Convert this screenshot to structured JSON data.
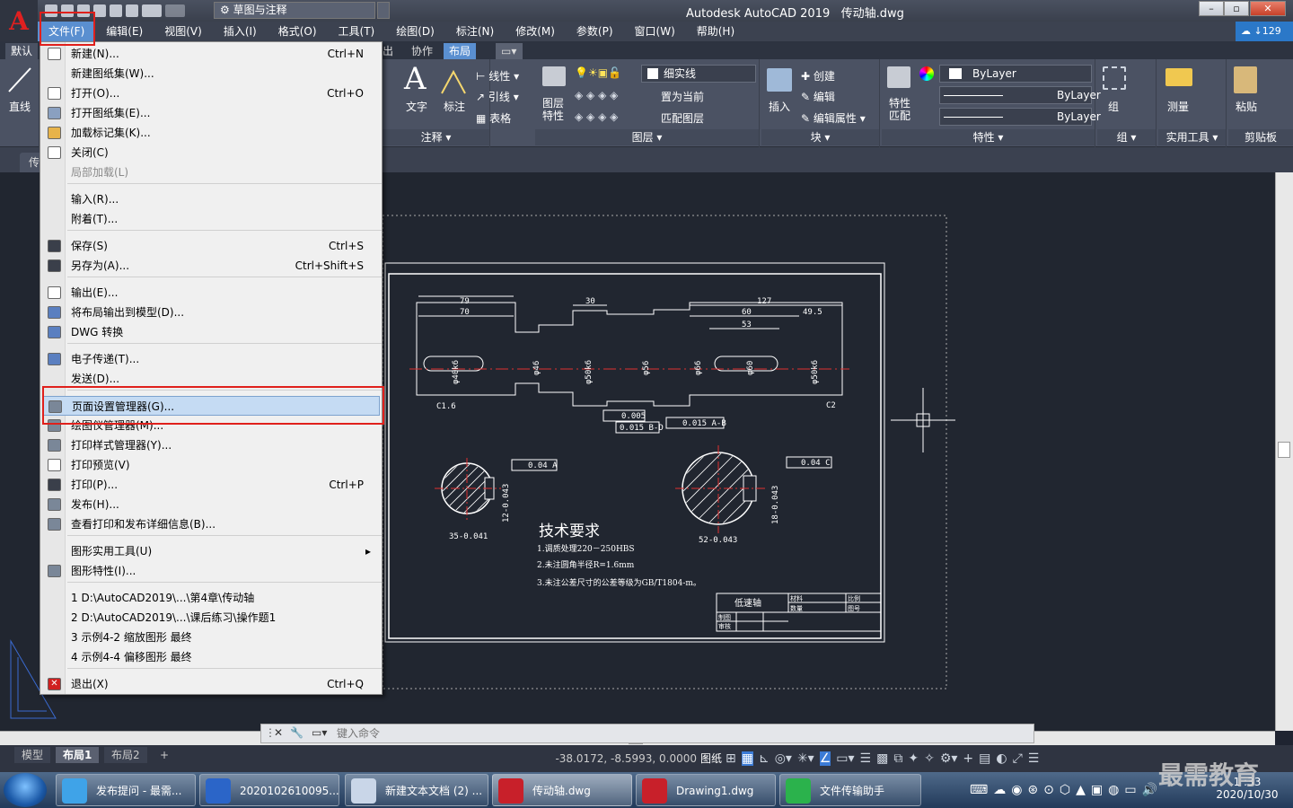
{
  "window": {
    "app_title": "Autodesk AutoCAD 2019",
    "file_name": "传动轴.dwg",
    "workspace": "草图与注释",
    "cloud_badge": "129"
  },
  "menubar": [
    "文件(F)",
    "编辑(E)",
    "视图(V)",
    "插入(I)",
    "格式(O)",
    "工具(T)",
    "绘图(D)",
    "标注(N)",
    "修改(M)",
    "参数(P)",
    "窗口(W)",
    "帮助(H)"
  ],
  "ribbon_tabs": [
    "默认",
    "出",
    "协作",
    "布局"
  ],
  "ribbon": {
    "draw_line": "直线",
    "annotation": {
      "text": "文字",
      "dim": "标注",
      "linear": "线性",
      "leader": "引线",
      "table": "表格",
      "title": "注释"
    },
    "layers": {
      "props": "图层\n特性",
      "current_layer": "细实线",
      "set_current": "置为当前",
      "match_layer": "匹配图层",
      "title": "图层"
    },
    "block": {
      "insert": "插入",
      "create": "创建",
      "edit": "编辑",
      "edit_attr": "编辑属性",
      "title": "块"
    },
    "properties": {
      "match": "特性\n匹配",
      "color": "ByLayer",
      "linetype": "ByLayer",
      "lineweight": "ByLayer",
      "title": "特性"
    },
    "group": {
      "label": "组",
      "title": "组"
    },
    "utilities": {
      "measure": "测量",
      "title": "实用工具"
    },
    "clipboard": {
      "paste": "粘贴",
      "title": "剪贴板"
    }
  },
  "doc_tab": "传",
  "file_menu": {
    "items": [
      {
        "label": "新建(N)...",
        "shortcut": "Ctrl+N",
        "disabled": false
      },
      {
        "label": "新建图纸集(W)...",
        "shortcut": "",
        "disabled": false
      },
      {
        "label": "打开(O)...",
        "shortcut": "Ctrl+O",
        "disabled": false
      },
      {
        "label": "打开图纸集(E)...",
        "shortcut": "",
        "disabled": false
      },
      {
        "label": "加载标记集(K)...",
        "shortcut": "",
        "disabled": false
      },
      {
        "label": "关闭(C)",
        "shortcut": "",
        "disabled": false
      },
      {
        "label": "局部加载(L)",
        "shortcut": "",
        "disabled": true
      },
      {
        "label": "输入(R)...",
        "shortcut": "",
        "disabled": false
      },
      {
        "label": "附着(T)...",
        "shortcut": "",
        "disabled": false
      },
      {
        "label": "保存(S)",
        "shortcut": "Ctrl+S",
        "disabled": false
      },
      {
        "label": "另存为(A)...",
        "shortcut": "Ctrl+Shift+S",
        "disabled": false
      },
      {
        "label": "输出(E)...",
        "shortcut": "",
        "disabled": false
      },
      {
        "label": "将布局输出到模型(D)...",
        "shortcut": "",
        "disabled": false
      },
      {
        "label": "DWG 转换",
        "shortcut": "",
        "disabled": false
      },
      {
        "label": "电子传递(T)...",
        "shortcut": "",
        "disabled": false
      },
      {
        "label": "发送(D)...",
        "shortcut": "",
        "disabled": false
      },
      {
        "label": "页面设置管理器(G)...",
        "shortcut": "",
        "disabled": false
      },
      {
        "label": "绘图仪管理器(M)...",
        "shortcut": "",
        "disabled": false
      },
      {
        "label": "打印样式管理器(Y)...",
        "shortcut": "",
        "disabled": false
      },
      {
        "label": "打印预览(V)",
        "shortcut": "",
        "disabled": false
      },
      {
        "label": "打印(P)...",
        "shortcut": "Ctrl+P",
        "disabled": false
      },
      {
        "label": "发布(H)...",
        "shortcut": "",
        "disabled": false
      },
      {
        "label": "查看打印和发布详细信息(B)...",
        "shortcut": "",
        "disabled": false
      },
      {
        "label": "图形实用工具(U)",
        "shortcut": "",
        "disabled": false
      },
      {
        "label": "图形特性(I)...",
        "shortcut": "",
        "disabled": false
      },
      {
        "label": "1 D:\\AutoCAD2019\\...\\第4章\\传动轴",
        "shortcut": "",
        "disabled": false
      },
      {
        "label": "2 D:\\AutoCAD2019\\...\\课后练习\\操作题1",
        "shortcut": "",
        "disabled": false
      },
      {
        "label": "3 示例4-2 缩放图形 最终",
        "shortcut": "",
        "disabled": false
      },
      {
        "label": "4 示例4-4 偏移图形 最终",
        "shortcut": "",
        "disabled": false
      },
      {
        "label": "退出(X)",
        "shortcut": "Ctrl+Q",
        "disabled": false
      }
    ]
  },
  "drawing": {
    "dims": [
      "79",
      "70",
      "30",
      "127",
      "60",
      "49.5",
      "53",
      "φ46",
      "φ56",
      "φ66",
      "φ60",
      "φ50k6",
      "φ50k6",
      "φ40k6",
      "C1.6",
      "C2",
      "0.005",
      "0.015 B-D",
      "0.015 A-B",
      "0.04 A",
      "0.04 C",
      "35-0.041",
      "52-0.043",
      "12-0.043",
      "18-0.043"
    ],
    "tech_title": "技术要求",
    "tech_notes": [
      "1.调质处理220－250HBS",
      "2.未注圆角半径R=1.6mm",
      "3.未注公差尺寸的公差等级为GB/T1804-m。"
    ],
    "title_block": {
      "name": "低速轴",
      "c1": "材料",
      "c2": "比例",
      "c3": "数量",
      "c4": "图号",
      "c5": "制图",
      "c6": "审核"
    }
  },
  "command": {
    "placeholder": "键入命令"
  },
  "layout_tabs": [
    "模型",
    "布局1",
    "布局2",
    "+"
  ],
  "status": {
    "coords": "-38.0172, -8.5993, 0.0000",
    "paper": "图纸"
  },
  "taskbar": {
    "items": [
      "发布提问 - 最需...",
      "2020102610095...",
      "新建文本文档 (2) ...",
      "传动轴.dwg",
      "Drawing1.dwg",
      "文件传输助手"
    ],
    "time": "1 :33",
    "date": "2020/10/30"
  },
  "watermark": "最需教育",
  "colors": {
    "accent_red": "#e0201c",
    "menu_highlight": "#c5dbf3",
    "drawing_bg": "#212630"
  }
}
